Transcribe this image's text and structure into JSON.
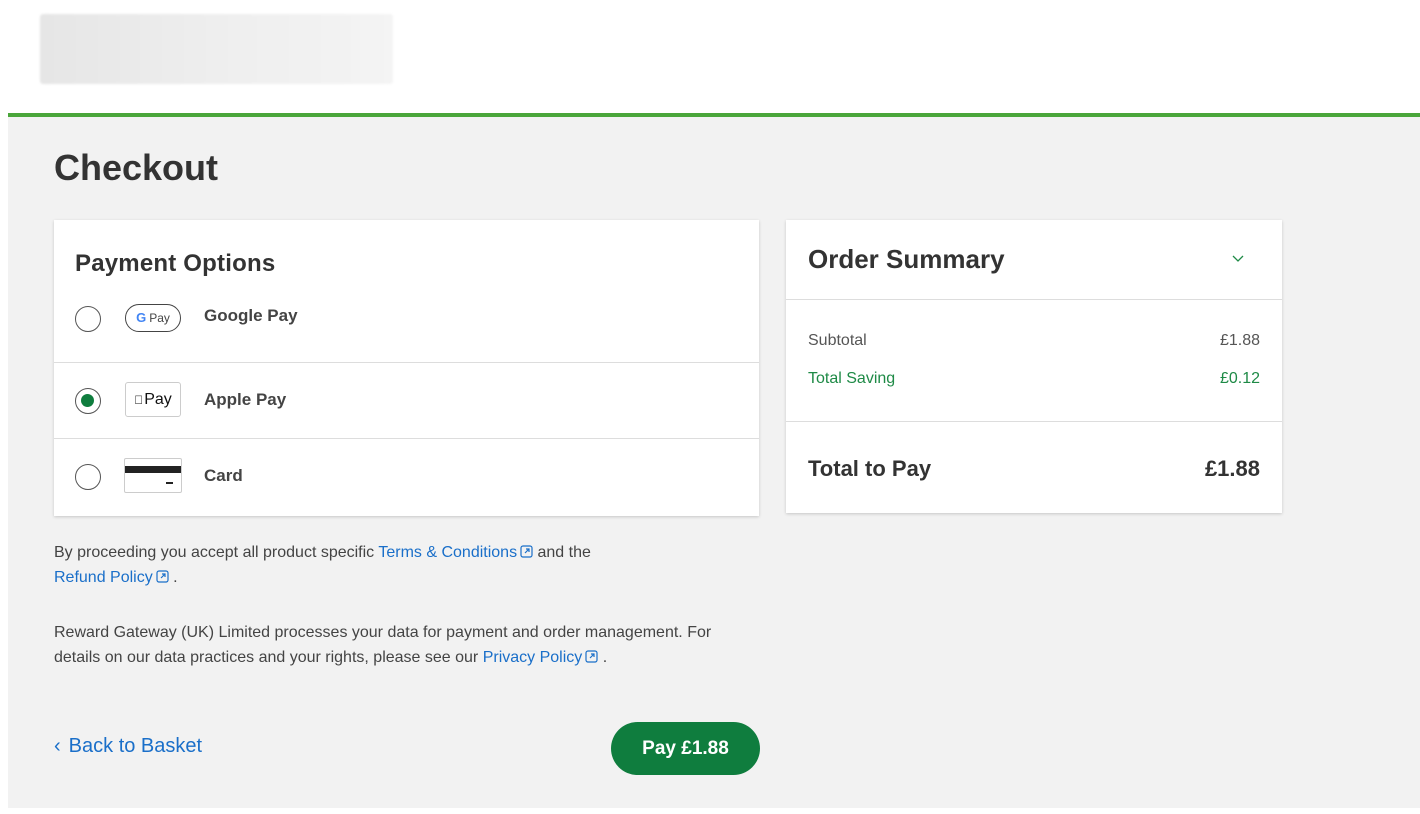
{
  "page": {
    "title": "Checkout"
  },
  "payment": {
    "title": "Payment Options",
    "options": [
      {
        "label": "Google Pay",
        "badge": "Pay",
        "badge_prefix": "G",
        "selected": false,
        "icon": "google-pay-icon"
      },
      {
        "label": "Apple Pay",
        "badge": "Pay",
        "badge_prefix": "",
        "selected": true,
        "icon": "apple-pay-icon"
      },
      {
        "label": "Card",
        "selected": false,
        "icon": "credit-card-icon"
      }
    ]
  },
  "legal": {
    "line1_prefix": "By proceeding you accept all product specific ",
    "terms_link": "Terms & Conditions",
    "line1_middle": " and the",
    "refund_link": "Refund Policy",
    "line1_suffix": ".",
    "line2_prefix": "Reward Gateway (UK) Limited processes your data for payment and order management. For details on our data practices and your rights, please see our ",
    "privacy_link": "Privacy Policy",
    "line2_suffix": "."
  },
  "actions": {
    "back_label": "Back to Basket",
    "pay_label": "Pay £1.88"
  },
  "summary": {
    "title": "Order Summary",
    "subtotal_label": "Subtotal",
    "subtotal_value": "£1.88",
    "saving_label": "Total Saving",
    "saving_value": "£0.12",
    "total_label": "Total to Pay",
    "total_value": "£1.88"
  },
  "colors": {
    "brand_green": "#0f7d3e",
    "header_bar": "#4aa63a",
    "link_blue": "#1a6fc9",
    "saving_green": "#1e8a46"
  }
}
